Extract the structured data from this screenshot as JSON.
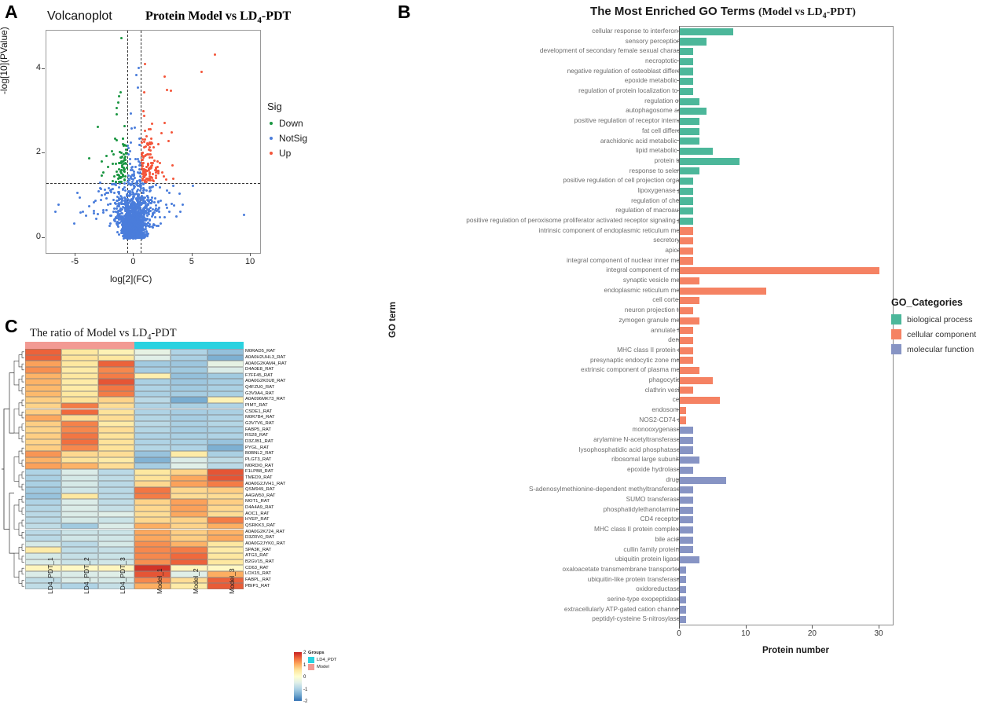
{
  "panels": {
    "a_letter": "A",
    "b_letter": "B",
    "c_letter": "C"
  },
  "panelA": {
    "title_left": "Volcanoplot",
    "title_right_html": "Protein  Model vs LD",
    "title_right_sub": "4",
    "title_right_tail": "-PDT",
    "ylabel": "-log[10](PValue)",
    "xlabel": "log[2](FC)",
    "legend_title": "Sig",
    "legend": [
      {
        "label": "Down",
        "color": "#1a9641"
      },
      {
        "label": "NotSig",
        "color": "#4a7ddb"
      },
      {
        "label": "Up",
        "color": "#f4553a"
      }
    ],
    "x_ticks": [
      "-5",
      "0",
      "5",
      "10"
    ],
    "y_ticks": [
      "0",
      "2",
      "4"
    ],
    "chart_data": {
      "type": "scatter",
      "title": "Volcanoplot Protein Model vs LD4-PDT",
      "xlabel": "log[2](FC)",
      "ylabel": "-log[10](PValue)",
      "xlim": [
        -7.5,
        10.8
      ],
      "ylim": [
        -0.35,
        4.9
      ],
      "thresholds": {
        "fc_left": -0.6,
        "fc_right": 0.6,
        "pvalue": 1.3
      },
      "series": [
        {
          "name": "Down",
          "color": "#1a9641",
          "n": 62
        },
        {
          "name": "NotSig",
          "color": "#4a7ddb",
          "n": 1900
        },
        {
          "name": "Up",
          "color": "#f4553a",
          "n": 110
        }
      ]
    }
  },
  "panelB": {
    "title_main": "The Most Enriched GO Terms ",
    "title_paren_open": "(Model vs LD",
    "title_sub": "4",
    "title_paren_close": "-PDT)",
    "xlabel": "Protein number",
    "ylabel": "GO term",
    "legend_title": "GO_Categories",
    "legend": [
      {
        "label": "biological process",
        "color": "#4cb79a"
      },
      {
        "label": "cellular component",
        "color": "#f58263"
      },
      {
        "label": "molecular function",
        "color": "#8794c4"
      }
    ],
    "x_ticks": [
      "0",
      "10",
      "20",
      "30"
    ],
    "chart_data": {
      "type": "bar",
      "orientation": "horizontal",
      "title": "The Most Enriched GO Terms (Model vs LD4-PDT)",
      "xlabel": "Protein number",
      "ylabel": "GO term",
      "xlim": [
        0,
        32
      ],
      "colors": {
        "biological process": "#4cb79a",
        "cellular component": "#f58263",
        "molecular function": "#8794c4"
      },
      "categories": [
        "cellular response to interferon-gamma",
        "sensory perception of pain",
        "development of secondary female sexual characteristics",
        "necroptotic process",
        "negative regulation of osteoblast differentiation",
        "epoxide metabolic process",
        "regulation of protein localization to nucleus",
        "regulation of growth",
        "autophagosome assembly",
        "positive regulation of receptor internalization",
        "fat cell differentiation",
        "arachidonic acid metabolic process",
        "lipid metabolic process",
        "protein transport",
        "response to selenium ion",
        "positive regulation of cell projection organization",
        "lipoxygenase pathway",
        "regulation of chemotaxis",
        "regulation of macroautophagy",
        "positive regulation of peroxisome proliferator activated receptor signaling pathway",
        "intrinsic component of endoplasmic reticulum membrane",
        "secretory vesicle",
        "apical cortex",
        "integral component of nuclear inner membrane",
        "integral component of membrane",
        "synaptic vesicle membrane",
        "endoplasmic reticulum membrane",
        "cell cortex region",
        "neuron projection terminus",
        "zymogen granule membrane",
        "annulate lamellae",
        "dense body",
        "MHC class II protein complex",
        "presynaptic endocytic zone membrane",
        "extrinsic component of plasma membrane",
        "phagocytic vesicle",
        "clathrin vesicle coat",
        "cell cortex",
        "endosome lumen",
        "NOS2-CD74 complex",
        "monooxygenase activity",
        "arylamine N-acetyltransferase activity",
        "lysophosphatidic acid phosphatase activity",
        "ribosomal large subunit binding",
        "epoxide hydrolase activity",
        "drug binding",
        "S-adenosylmethionine-dependent methyltransferase activity",
        "SUMO transferase activity",
        "phosphatidylethanolamine binding",
        "CD4 receptor binding",
        "MHC class II protein complex binding",
        "bile acid binding",
        "cullin family protein binding",
        "ubiquitin protein ligase activity",
        "oxaloacetate transmembrane transporter activity",
        "ubiquitin-like protein transferase activity",
        "oxidoreductase activity",
        "serine-type exopeptidase activity",
        "extracellularly ATP-gated cation channel activity",
        "peptidyl-cysteine S-nitrosylase activity"
      ],
      "values": [
        8,
        4,
        2,
        2,
        2,
        2,
        2,
        3,
        4,
        3,
        3,
        3,
        5,
        9,
        3,
        2,
        2,
        2,
        2,
        2,
        2,
        2,
        2,
        2,
        30,
        3,
        13,
        3,
        2,
        3,
        2,
        2,
        2,
        2,
        3,
        5,
        2,
        6,
        1,
        1,
        2,
        2,
        2,
        3,
        2,
        7,
        2,
        2,
        2,
        2,
        2,
        2,
        2,
        3,
        1,
        1,
        1,
        1,
        1,
        1
      ],
      "groups": [
        "biological process",
        "biological process",
        "biological process",
        "biological process",
        "biological process",
        "biological process",
        "biological process",
        "biological process",
        "biological process",
        "biological process",
        "biological process",
        "biological process",
        "biological process",
        "biological process",
        "biological process",
        "biological process",
        "biological process",
        "biological process",
        "biological process",
        "biological process",
        "cellular component",
        "cellular component",
        "cellular component",
        "cellular component",
        "cellular component",
        "cellular component",
        "cellular component",
        "cellular component",
        "cellular component",
        "cellular component",
        "cellular component",
        "cellular component",
        "cellular component",
        "cellular component",
        "cellular component",
        "cellular component",
        "cellular component",
        "cellular component",
        "cellular component",
        "cellular component",
        "molecular function",
        "molecular function",
        "molecular function",
        "molecular function",
        "molecular function",
        "molecular function",
        "molecular function",
        "molecular function",
        "molecular function",
        "molecular function",
        "molecular function",
        "molecular function",
        "molecular function",
        "molecular function",
        "molecular function",
        "molecular function",
        "molecular function",
        "molecular function",
        "molecular function",
        "molecular function"
      ]
    }
  },
  "panelC": {
    "title_main": "The ratio of Model vs LD",
    "title_sub": "4",
    "title_tail": "-PDT",
    "group_legend_title": "Groups",
    "group_legend": [
      {
        "label": "LD4_PDT",
        "color": "#2ad2e0"
      },
      {
        "label": "Model",
        "color": "#f29a93"
      }
    ],
    "colorbar_ticks": [
      "2",
      "1",
      "0",
      "-1",
      "-2"
    ],
    "columns": [
      "LD4_PDT_1",
      "LD4_PDT_2",
      "LD4_PDT_3",
      "Model_1",
      "Model_2",
      "Model_3"
    ],
    "column_groups": [
      "Model",
      "Model",
      "Model",
      "LD4_PDT",
      "LD4_PDT",
      "LD4_PDT"
    ],
    "chart_data": {
      "type": "heatmap",
      "title": "The ratio of Model vs LD4-PDT",
      "columns": [
        "LD4_PDT_1",
        "LD4_PDT_2",
        "LD4_PDT_3",
        "Model_1",
        "Model_2",
        "Model_3"
      ],
      "zlim": [
        -2,
        2
      ],
      "rows": [
        {
          "label": "M0RAD5_RAT",
          "values": [
            1.5,
            0.35,
            0.2,
            -0.2,
            -0.7,
            -1.0
          ]
        },
        {
          "label": "A0A0H2UHL3_RAT",
          "values": [
            1.5,
            0.4,
            0.35,
            -0.25,
            -0.75,
            -1.25
          ]
        },
        {
          "label": "A0A0G2KAM4_RAT",
          "values": [
            1.0,
            0.35,
            1.5,
            -0.85,
            -0.9,
            -0.2
          ]
        },
        {
          "label": "D4A0E8_RAT",
          "values": [
            1.15,
            0.3,
            1.2,
            -0.8,
            -0.85,
            -0.3
          ]
        },
        {
          "label": "F7FF45_RAT",
          "values": [
            0.85,
            0.35,
            1.3,
            0.25,
            -1.0,
            -0.85
          ]
        },
        {
          "label": "A0A0G2K0U8_RAT",
          "values": [
            0.85,
            0.3,
            1.6,
            -0.75,
            -0.9,
            -0.8
          ]
        },
        {
          "label": "Q4FZU0_RAT",
          "values": [
            0.8,
            0.3,
            1.35,
            -0.7,
            -0.85,
            -0.75
          ]
        },
        {
          "label": "G3V9A4_RAT",
          "values": [
            0.8,
            0.35,
            1.3,
            -0.75,
            -0.8,
            -0.75
          ]
        },
        {
          "label": "A0A096MK73_RAT",
          "values": [
            0.6,
            0.4,
            0.55,
            -0.6,
            -1.3,
            0.2
          ]
        },
        {
          "label": "PIMT_RAT",
          "values": [
            0.55,
            1.3,
            0.45,
            -0.7,
            -0.75,
            -0.7
          ]
        },
        {
          "label": "CSDE1_RAT",
          "values": [
            0.6,
            1.45,
            0.4,
            -0.7,
            -0.8,
            -0.75
          ]
        },
        {
          "label": "M0R7B4_RAT",
          "values": [
            0.95,
            0.45,
            0.45,
            -0.65,
            -0.8,
            -0.7
          ]
        },
        {
          "label": "G3V7V6_RAT",
          "values": [
            0.6,
            1.25,
            0.3,
            -0.6,
            -0.75,
            -0.65
          ]
        },
        {
          "label": "FABP5_RAT",
          "values": [
            0.55,
            1.2,
            0.45,
            -0.65,
            -0.8,
            -0.75
          ]
        },
        {
          "label": "RS28_RAT",
          "values": [
            0.6,
            1.35,
            0.4,
            -0.7,
            -0.75,
            -0.7
          ]
        },
        {
          "label": "D3ZJB1_RAT",
          "values": [
            0.55,
            1.4,
            0.4,
            -0.7,
            -0.75,
            -0.95
          ]
        },
        {
          "label": "PYGL_RAT",
          "values": [
            0.6,
            1.2,
            0.4,
            -0.65,
            -0.7,
            -1.25
          ]
        },
        {
          "label": "B0BNL2_RAT",
          "values": [
            1.1,
            0.5,
            0.45,
            -0.95,
            0.3,
            -0.75
          ]
        },
        {
          "label": "PLGT3_RAT",
          "values": [
            0.85,
            0.4,
            0.3,
            -1.2,
            -0.3,
            -0.55
          ]
        },
        {
          "label": "M0RDI0_RAT",
          "values": [
            1.0,
            0.85,
            0.45,
            -0.8,
            -0.25,
            -0.6
          ]
        },
        {
          "label": "F1LPB8_RAT",
          "values": [
            -0.7,
            -0.3,
            -0.6,
            0.35,
            0.55,
            1.6
          ]
        },
        {
          "label": "TMED9_RAT",
          "values": [
            -0.75,
            -0.35,
            -0.55,
            0.4,
            0.95,
            1.6
          ]
        },
        {
          "label": "A0A0G2JVH1_RAT",
          "values": [
            -0.75,
            -0.35,
            -0.6,
            0.5,
            1.0,
            1.3
          ]
        },
        {
          "label": "QSM949_RAT",
          "values": [
            -0.85,
            -0.4,
            -0.6,
            1.35,
            0.5,
            0.6
          ]
        },
        {
          "label": "A4GW50_RAT",
          "values": [
            -0.95,
            0.35,
            -0.6,
            1.3,
            0.45,
            0.45
          ]
        },
        {
          "label": "MOT1_RAT",
          "values": [
            -0.7,
            -0.3,
            -0.55,
            0.55,
            1.0,
            0.6
          ]
        },
        {
          "label": "D4A4A9_RAT",
          "values": [
            -0.65,
            -0.3,
            -0.5,
            0.5,
            1.0,
            0.5
          ]
        },
        {
          "label": "AOC1_RAT",
          "values": [
            -0.6,
            -0.3,
            -0.25,
            0.45,
            0.95,
            0.45
          ]
        },
        {
          "label": "HYEP_RAT",
          "values": [
            -0.6,
            -0.35,
            -0.45,
            0.5,
            0.55,
            1.3
          ]
        },
        {
          "label": "QSRKK3_RAT",
          "values": [
            -0.55,
            -0.85,
            -0.3,
            0.9,
            0.55,
            0.9
          ]
        },
        {
          "label": "A0A0G2K724_RAT",
          "values": [
            -0.6,
            -0.45,
            -0.45,
            0.95,
            0.6,
            0.85
          ]
        },
        {
          "label": "D3ZRV0_RAT",
          "values": [
            -0.6,
            -0.4,
            -0.4,
            0.95,
            0.6,
            0.95
          ]
        },
        {
          "label": "A0A0G2JYK0_RAT",
          "values": [
            -0.35,
            -0.6,
            -0.35,
            1.15,
            0.85,
            0.35
          ]
        },
        {
          "label": "SPA3K_RAT",
          "values": [
            0.3,
            -0.55,
            -0.5,
            1.2,
            1.3,
            0.3
          ]
        },
        {
          "label": "ATG3_RAT",
          "values": [
            -0.35,
            -0.5,
            -0.45,
            1.2,
            1.45,
            0.35
          ]
        },
        {
          "label": "B2GV15_RAT",
          "values": [
            -0.3,
            -0.45,
            -0.4,
            1.15,
            1.5,
            0.35
          ]
        },
        {
          "label": "CD63_RAT",
          "values": [
            0.15,
            0.1,
            0.15,
            1.85,
            0.15,
            0.1
          ]
        },
        {
          "label": "LOX15_RAT",
          "values": [
            -0.3,
            -0.3,
            -0.25,
            1.6,
            -0.25,
            0.9
          ]
        },
        {
          "label": "FABPL_RAT",
          "values": [
            -0.55,
            -0.3,
            -0.35,
            1.2,
            0.45,
            1.5
          ]
        },
        {
          "label": "PBIP1_RAT",
          "values": [
            -0.55,
            -0.7,
            -0.5,
            0.9,
            0.3,
            1.55
          ]
        }
      ]
    }
  }
}
